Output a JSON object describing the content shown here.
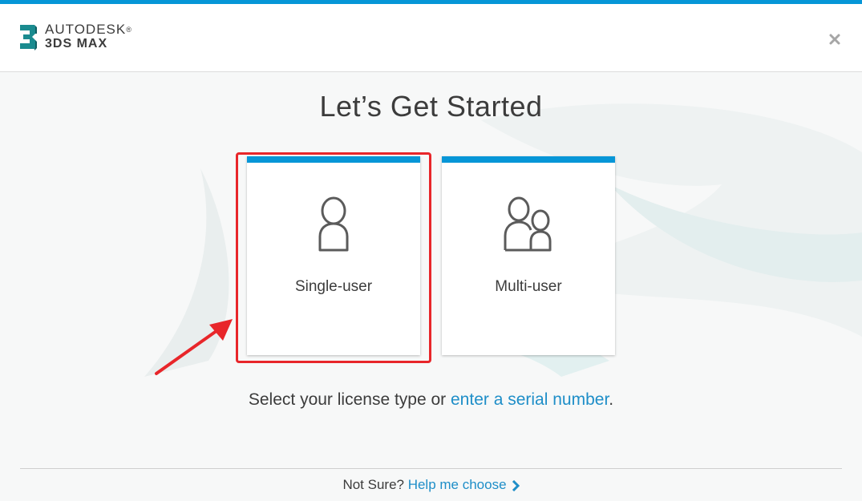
{
  "colors": {
    "accent": "#0696d7",
    "link": "#1e8ec8",
    "highlight": "#e8262a"
  },
  "header": {
    "logo_brand": "AUTODESK",
    "logo_trademark": "®",
    "logo_product": "3DS MAX",
    "logo_mark": "3",
    "close_icon": "close-icon"
  },
  "main": {
    "title": "Let’s Get Started",
    "cards": [
      {
        "label": "Single-user",
        "icon": "single-user-icon"
      },
      {
        "label": "Multi-user",
        "icon": "multi-user-icon"
      }
    ],
    "license_prefix": "Select your license type or ",
    "serial_link": "enter a serial number",
    "license_suffix": "."
  },
  "footer": {
    "not_sure": "Not Sure? ",
    "help_link": "Help me choose",
    "chevron_icon": "chevron-right-icon"
  }
}
